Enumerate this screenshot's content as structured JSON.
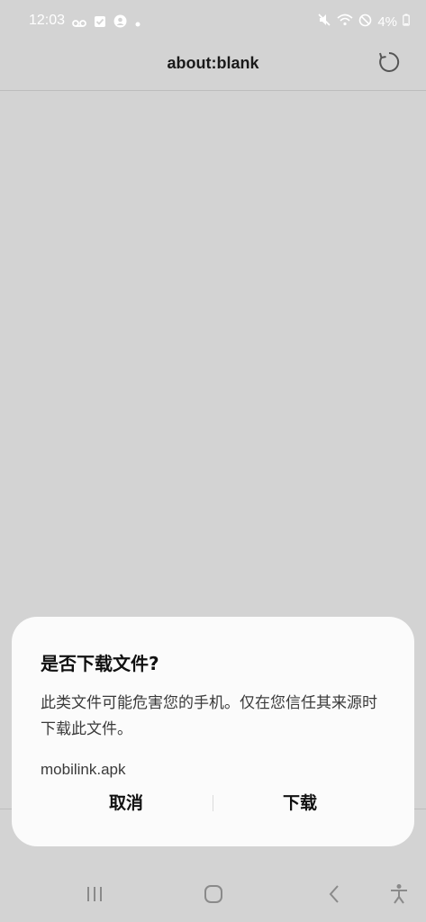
{
  "status_bar": {
    "time": "12:03",
    "battery": "4%",
    "icons_left": [
      "voicemail-icon",
      "task-check-icon",
      "account-circle-icon",
      "dot-icon"
    ],
    "icons_right": [
      "mute-icon",
      "wifi-icon",
      "do-not-disturb-icon",
      "battery-icon"
    ]
  },
  "browser": {
    "title": "about:blank",
    "refresh_icon": "refresh-icon"
  },
  "dialog": {
    "title": "是否下载文件?",
    "message": "此类文件可能危害您的手机。仅在您信任其来源时下载此文件。",
    "filename": "mobilink.apk",
    "cancel_label": "取消",
    "download_label": "下载"
  },
  "nav_bar": {
    "buttons": [
      "recent-apps-icon",
      "home-icon",
      "back-icon",
      "accessibility-icon"
    ]
  }
}
